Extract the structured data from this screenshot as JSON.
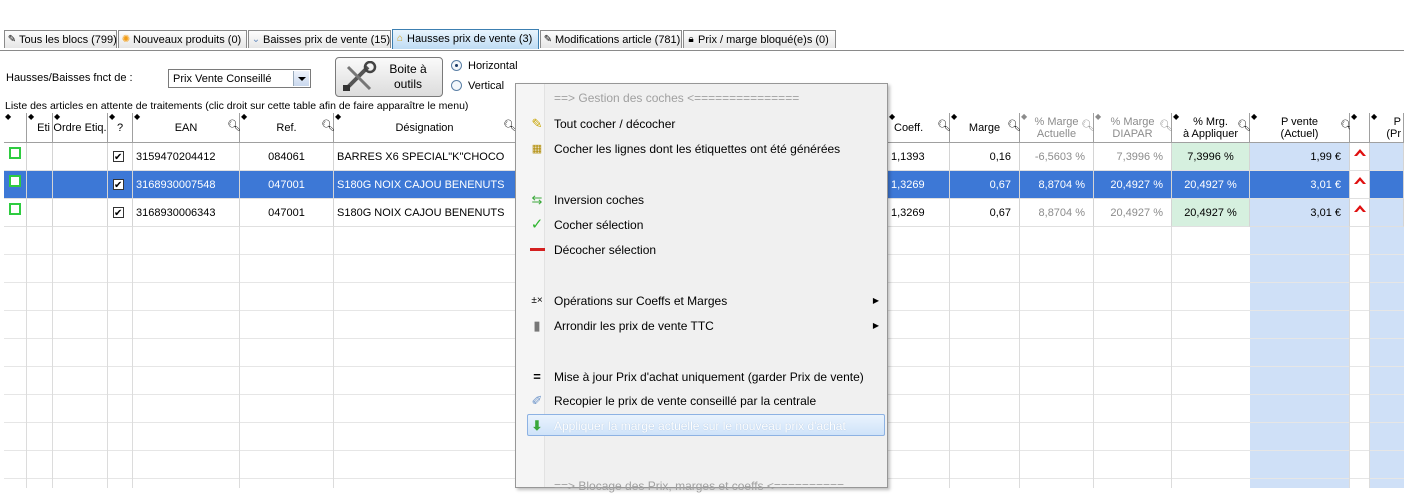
{
  "tabs": [
    {
      "label": "Tous les blocs (799)",
      "icon": "pencil-icon"
    },
    {
      "label": "Nouveaux produits (0)",
      "icon": "sun-icon"
    },
    {
      "label": "Baisses prix de vente (15)",
      "icon": "chevron-down-icon"
    },
    {
      "label": "Hausses prix de vente (3)",
      "icon": "house-icon"
    },
    {
      "label": "Modifications article (781)",
      "icon": "pencil-icon"
    },
    {
      "label": "Prix / marge bloqué(e)s (0)",
      "icon": "lock-icon"
    }
  ],
  "controls": {
    "hausses_label": "Hausses/Baisses fnct de :",
    "select_value": "Prix Vente Conseillé",
    "toolbox_label_1": "Boite à",
    "toolbox_label_2": "outils",
    "radio_horizontal": "Horizontal",
    "radio_vertical": "Vertical",
    "list_caption": "Liste des articles en attente de traitements (clic droit sur cette table afin de faire apparaître le menu)"
  },
  "columns": {
    "eti": "Eti",
    "ordre": "Ordre Etiq.",
    "q": "?",
    "ean": "EAN",
    "ref": "Ref.",
    "designation": "Désignation",
    "coeff": "Coeff.",
    "marge": "Marge",
    "marge_actuelle_1": "% Marge",
    "marge_actuelle_2": "Actuelle",
    "marge_diapar_1": "% Marge",
    "marge_diapar_2": "DIAPAR",
    "mrg_appliquer_1": "% Mrg.",
    "mrg_appliquer_2": "à Appliquer",
    "pvente_1": "P vente",
    "pvente_2": "(Actuel)",
    "last_1": "P",
    "last_2": "(Pr"
  },
  "rows": [
    {
      "ean": "3159470204412",
      "ref": "084061",
      "designation": "BARRES X6 SPECIAL\"K\"CHOCO",
      "coeff": "1,1393",
      "marge": "0,16",
      "marge_actuelle": "-6,5603 %",
      "marge_diapar": "7,3996 %",
      "mrg_appliquer": "7,3996 %",
      "pvente": "1,99 €"
    },
    {
      "ean": "3168930007548",
      "ref": "047001",
      "designation": "S180G NOIX CAJOU BENENUTS",
      "coeff": "1,3269",
      "marge": "0,67",
      "marge_actuelle": "8,8704 %",
      "marge_diapar": "20,4927 %",
      "mrg_appliquer": "20,4927 %",
      "pvente": "3,01 €"
    },
    {
      "ean": "3168930006343",
      "ref": "047001",
      "designation": "S180G NOIX CAJOU BENENUTS",
      "coeff": "1,3269",
      "marge": "0,67",
      "marge_actuelle": "8,8704 %",
      "marge_diapar": "20,4927 %",
      "mrg_appliquer": "20,4927 %",
      "pvente": "3,01 €"
    }
  ],
  "context_menu": {
    "items": [
      {
        "label": "==> Gestion des coches <===============",
        "icon": ""
      },
      {
        "label": "Tout cocher / décocher",
        "icon": "pencil-check-icon"
      },
      {
        "label": "Cocher les lignes dont les étiquettes ont été générées",
        "icon": "barcode-icon"
      },
      {
        "label": "Inversion coches",
        "icon": "swap-icon"
      },
      {
        "label": "Cocher sélection",
        "icon": "check-icon"
      },
      {
        "label": "Décocher sélection",
        "icon": "minus-icon"
      },
      {
        "label": "Opérations sur Coeffs et Marges",
        "icon": "math-icon"
      },
      {
        "label": "Arrondir les prix de vente TTC",
        "icon": "bin-icon"
      },
      {
        "label": "Mise à jour Prix d'achat uniquement (garder Prix de vente)",
        "icon": "equals-icon"
      },
      {
        "label": "Recopier le prix de vente conseillé par la centrale",
        "icon": "copy-icon"
      },
      {
        "label": "Appliquer la marge actuelle sur le nouveau prix d'achat",
        "icon": "arrow-down-icon"
      },
      {
        "label": "==> Blocage des Prix, marges et coeffs <==========",
        "icon": ""
      }
    ]
  },
  "colors": {
    "selection": "#3d78d6",
    "green_col": "#d6f0df",
    "blue_col": "#cfe0f7",
    "active_tab": "#bfdcf4"
  }
}
